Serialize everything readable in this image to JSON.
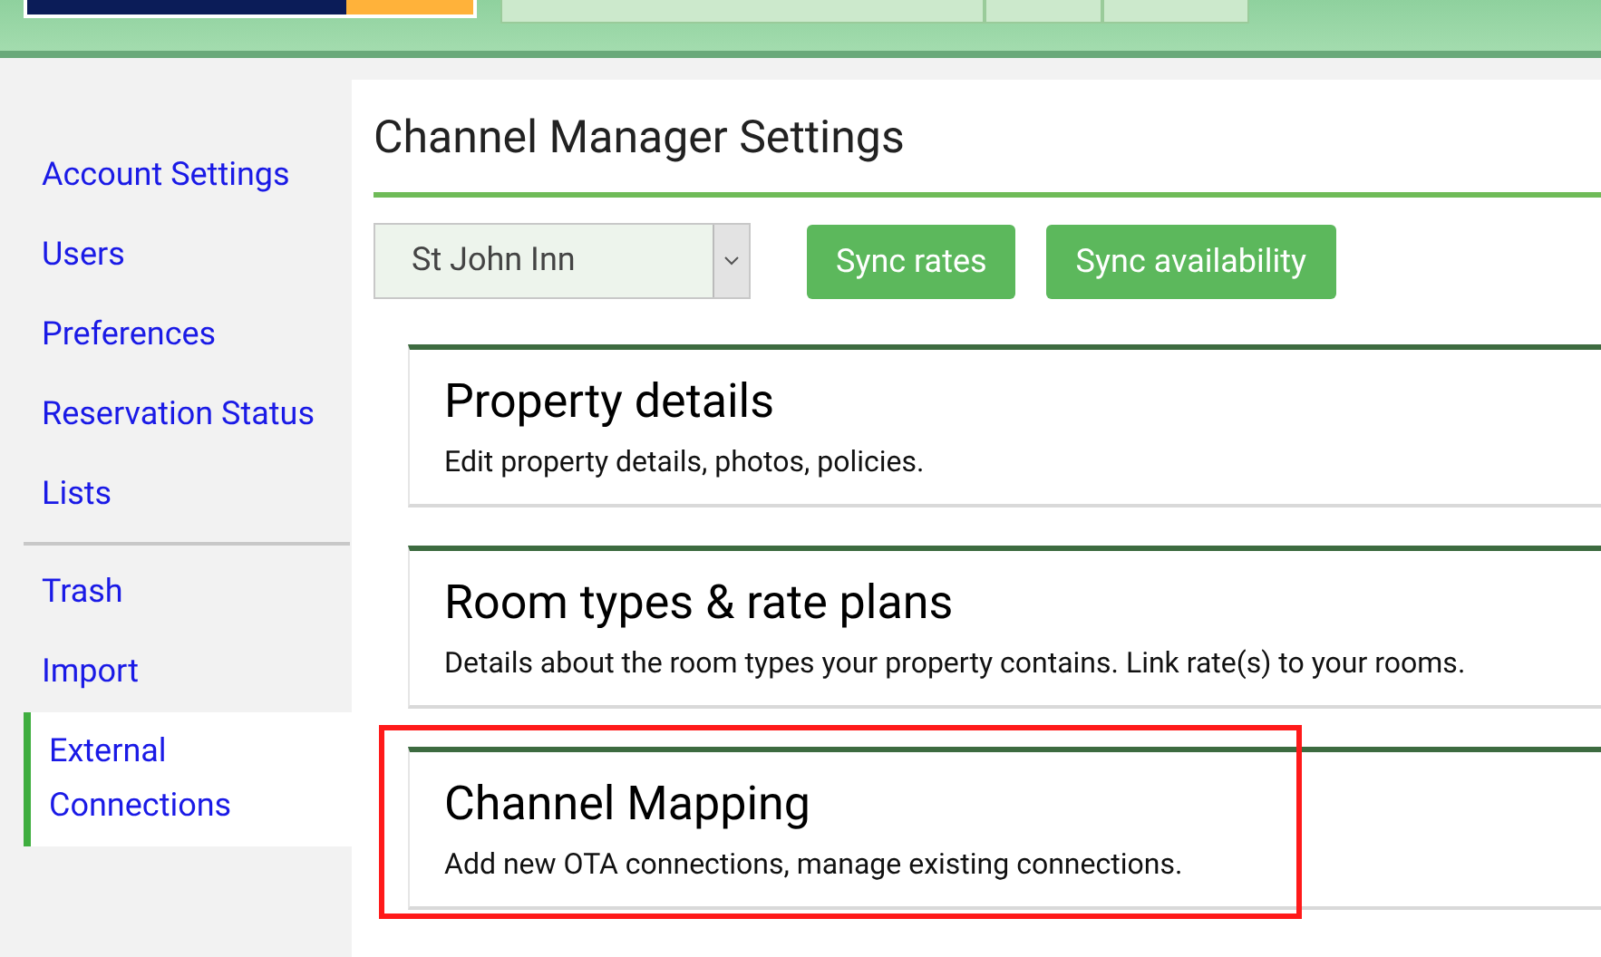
{
  "sidebar": {
    "items": [
      {
        "label": "Account Settings",
        "selected": false,
        "divider_after": false
      },
      {
        "label": "Users",
        "selected": false,
        "divider_after": false
      },
      {
        "label": "Preferences",
        "selected": false,
        "divider_after": false
      },
      {
        "label": "Reservation Status",
        "selected": false,
        "divider_after": false
      },
      {
        "label": "Lists",
        "selected": false,
        "divider_after": true
      },
      {
        "label": "Trash",
        "selected": false,
        "divider_after": false
      },
      {
        "label": "Import",
        "selected": false,
        "divider_after": false
      },
      {
        "label": "External Connections",
        "selected": true,
        "divider_after": false
      }
    ]
  },
  "page_title": "Channel Manager Settings",
  "property_select": {
    "value": "St John Inn"
  },
  "buttons": [
    "Sync rates",
    "Sync availability"
  ],
  "cards": [
    {
      "title": "Property details",
      "description": "Edit property details, photos, policies.",
      "highlighted": false
    },
    {
      "title": "Room types & rate plans",
      "description": "Details about the room types your property contains. Link rate(s) to your rooms.",
      "highlighted": false
    },
    {
      "title": "Channel Mapping",
      "description": "Add new OTA connections, manage existing connections.",
      "highlighted": true
    }
  ]
}
